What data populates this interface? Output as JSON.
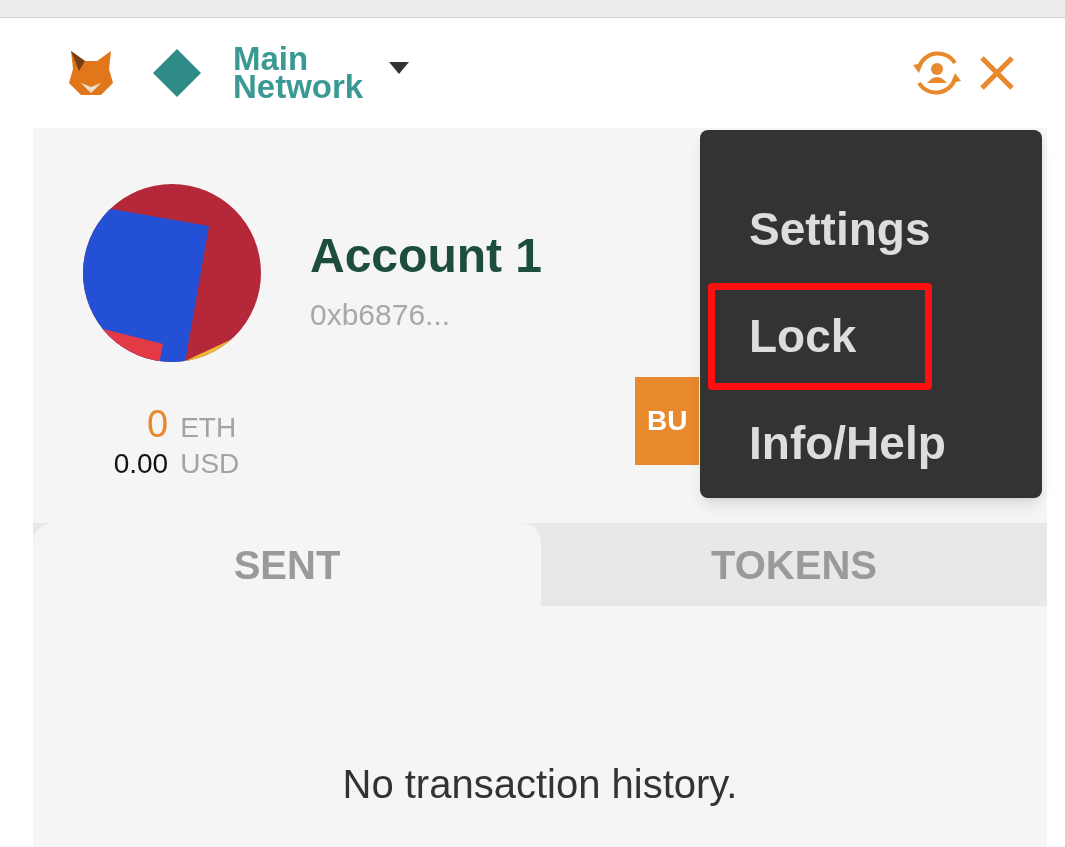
{
  "header": {
    "network": {
      "name_line_1": "Main",
      "name_line_2": "Network"
    }
  },
  "account": {
    "name": "Account 1",
    "address": "0xb6876...",
    "balance": {
      "eth_amount": "0",
      "eth_unit": "ETH",
      "usd_amount": "0.00",
      "usd_unit": "USD"
    }
  },
  "buttons": [
    {
      "label": "BU"
    }
  ],
  "menu": {
    "items": [
      {
        "label": "Settings",
        "highlighted": false
      },
      {
        "label": "Lock",
        "highlighted": true
      },
      {
        "label": "Info/Help",
        "highlighted": false
      }
    ]
  },
  "tabs": [
    {
      "label": "SENT",
      "selected": true
    },
    {
      "label": "TOKENS",
      "selected": false
    }
  ],
  "empty_message": "No transaction history."
}
